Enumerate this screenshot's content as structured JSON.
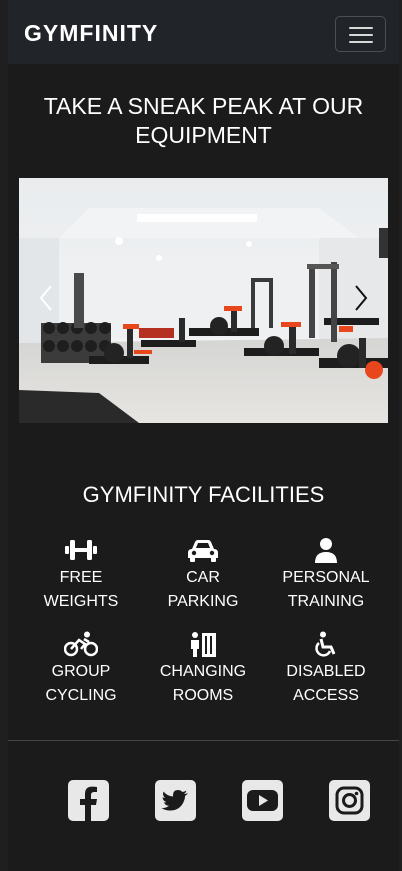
{
  "navbar": {
    "brand": "GYMFINITY",
    "toggle_icon": "hamburger-menu-icon"
  },
  "equipment": {
    "heading": "TAKE A SNEAK PEAK AT OUR EQUIPMENT"
  },
  "carousel": {
    "prev_icon": "chevron-left-icon",
    "next_icon": "chevron-right-icon"
  },
  "facilities": {
    "heading": "GYMFINITY FACILITIES",
    "items": [
      {
        "line1": "FREE",
        "line2": "WEIGHTS",
        "icon": "dumbbell-icon"
      },
      {
        "line1": "CAR",
        "line2": "PARKING",
        "icon": "car-icon"
      },
      {
        "line1": "PERSONAL",
        "line2": "TRAINING",
        "icon": "person-icon"
      },
      {
        "line1": "GROUP",
        "line2": "CYCLING",
        "icon": "bicycle-icon"
      },
      {
        "line1": "CHANGING",
        "line2": "ROOMS",
        "icon": "restroom-icon"
      },
      {
        "line1": "DISABLED",
        "line2": "ACCESS",
        "icon": "wheelchair-icon"
      }
    ]
  },
  "footer": {
    "social": [
      {
        "icon": "facebook-icon"
      },
      {
        "icon": "twitter-icon"
      },
      {
        "icon": "youtube-icon"
      },
      {
        "icon": "instagram-icon"
      }
    ]
  },
  "colors": {
    "background": "#1b1b1b",
    "navbar": "#212529",
    "accent_in_photo": "#e8471e"
  }
}
